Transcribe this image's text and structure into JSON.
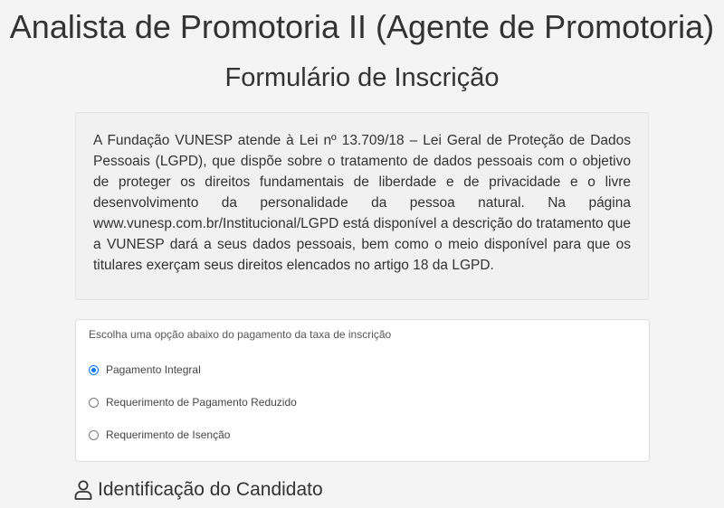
{
  "header": {
    "title": "Analista de Promotoria II (Agente de Promotoria)",
    "subtitle": "Formulário de Inscrição"
  },
  "lgpd": {
    "text": "A Fundação VUNESP atende à Lei nº 13.709/18 – Lei Geral de Proteção de Dados Pessoais (LGPD), que dispõe sobre o tratamento de dados pessoais com o objetivo de proteger os direitos fundamentais de liberdade e de privacidade e o livre desenvolvimento da personalidade da pessoa natural. Na página www.vunesp.com.br/Institucional/LGPD está disponível a descrição do tratamento que a VUNESP dará a seus dados pessoais, bem como o meio disponível para que os titulares exerçam seus direitos elencados no artigo 18 da LGPD."
  },
  "payment": {
    "legend": "Escolha uma opção abaixo do pagamento da taxa de inscrição",
    "options": [
      {
        "label": "Pagamento Integral",
        "checked": true
      },
      {
        "label": "Requerimento de Pagamento Reduzido",
        "checked": false
      },
      {
        "label": "Requerimento de Isenção",
        "checked": false
      }
    ]
  },
  "candidate_section": {
    "icon": "user-icon",
    "title": "Identificação do Candidato"
  },
  "colors": {
    "background": "#f4f4f4",
    "radio_accent": "#0075ff",
    "text": "#333333"
  }
}
